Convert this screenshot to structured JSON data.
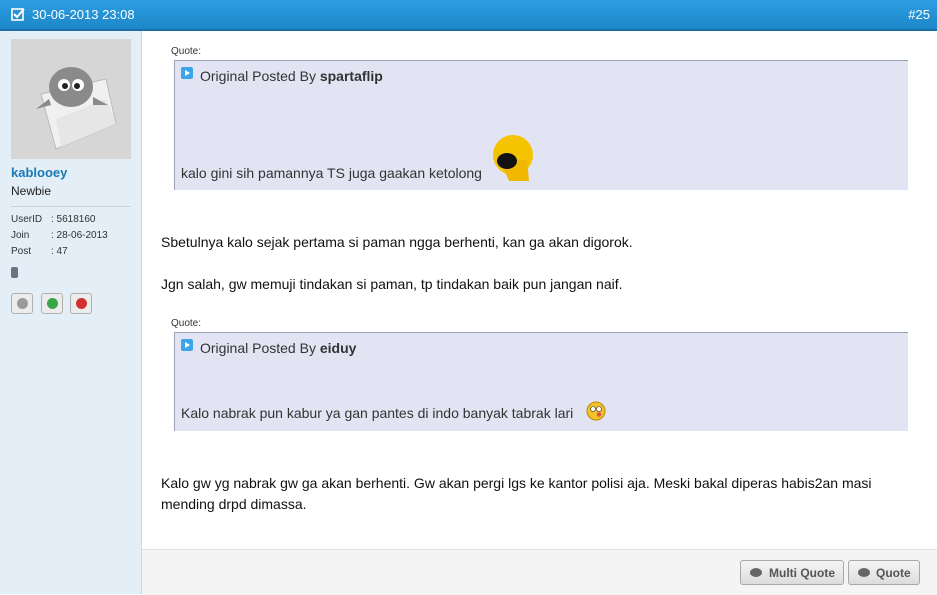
{
  "header": {
    "date": "30-06-2013 23:08",
    "post_number": "#25"
  },
  "user": {
    "username": "kablooey",
    "title": "Newbie",
    "userid_label": "UserID",
    "userid": ": 5618160",
    "join_label": "Join",
    "join": ": 28-06-2013",
    "post_label": "Post",
    "post": ": 47"
  },
  "quote1": {
    "label": "Quote:",
    "prefix": "Original Posted By",
    "author": "spartaflip",
    "text": "kalo gini sih pamannya TS juga gaakan ketolong"
  },
  "message1": "Sbetulnya kalo sejak pertama si paman ngga berhenti, kan ga akan digorok.",
  "message2": "Jgn salah, gw memuji tindakan si paman, tp tindakan baik pun jangan naif.",
  "quote2": {
    "label": "Quote:",
    "prefix": "Original Posted By",
    "author": "eiduy",
    "text": "Kalo nabrak pun kabur ya gan pantes di indo banyak tabrak lari"
  },
  "message3_line1": "Kalo gw yg nabrak gw ga akan berhenti. Gw akan pergi lgs ke kantor polisi aja. Meski bakal diperas habis2an masi",
  "message3_line2": "mending drpd dimassa.",
  "buttons": {
    "multi_quote": "Multi Quote",
    "quote": "Quote"
  },
  "colors": {
    "header": "#1d87c9",
    "username": "#1a79b9",
    "quote_bg": "#e2e4f3",
    "sidebar_bg": "#e3eef6"
  }
}
